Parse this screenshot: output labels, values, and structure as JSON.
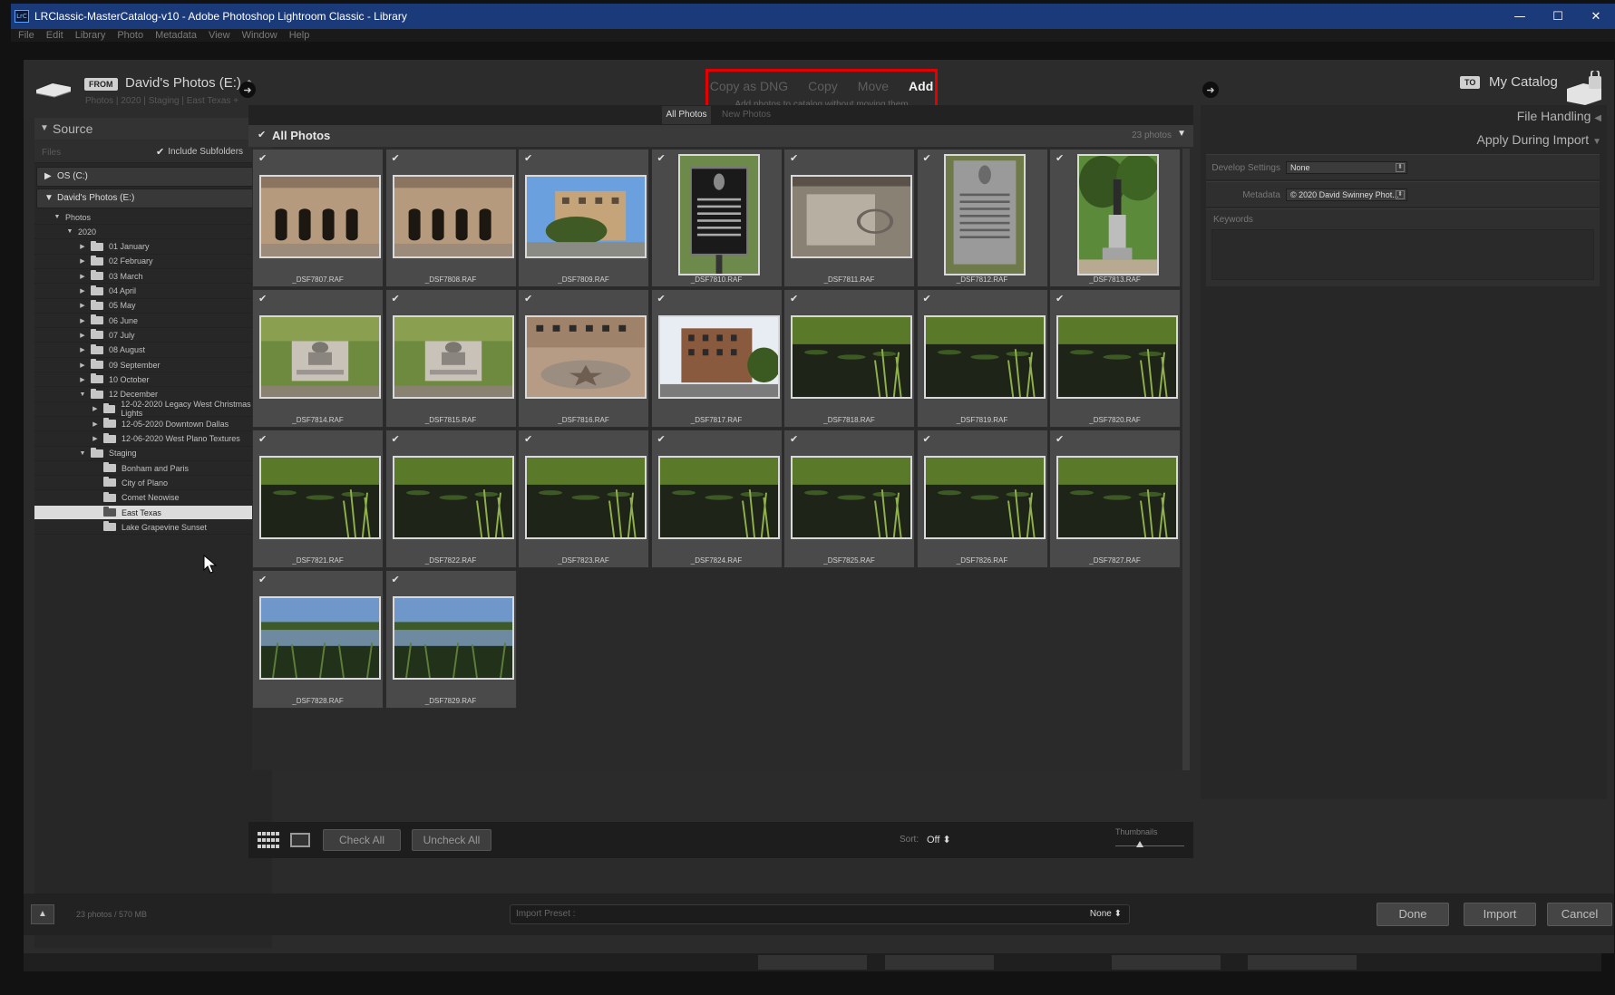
{
  "window": {
    "app_icon": "LrC",
    "title": "LRClassic-MasterCatalog-v10 - Adobe Photoshop Lightroom Classic - Library",
    "controls": [
      "—",
      "☐",
      "✕"
    ]
  },
  "menu": [
    "File",
    "Edit",
    "Library",
    "Photo",
    "Metadata",
    "View",
    "Window",
    "Help"
  ],
  "header": {
    "from_badge": "FROM",
    "source_name": "David's Photos (E:)",
    "source_path": "Photos | 2020 | Staging | East Texas +",
    "modes": [
      "Copy as DNG",
      "Copy",
      "Move",
      "Add"
    ],
    "active_mode": "Add",
    "mode_description": "Add photos to catalog without moving them",
    "to_badge": "TO",
    "dest_name": "My Catalog",
    "highlight_color": "#e40000"
  },
  "source": {
    "title": "Source",
    "files_label": "Files",
    "include_subfolders": "Include Subfolders",
    "volumes": [
      "OS (C:)",
      "David's Photos (E:)"
    ],
    "tree": [
      {
        "label": "Photos",
        "indent": 1,
        "tri": "▼",
        "folder": false
      },
      {
        "label": "2020",
        "indent": 2,
        "tri": "▼",
        "folder": false
      },
      {
        "label": "01 January",
        "indent": 3,
        "tri": "▶",
        "folder": true
      },
      {
        "label": "02 February",
        "indent": 3,
        "tri": "▶",
        "folder": true
      },
      {
        "label": "03 March",
        "indent": 3,
        "tri": "▶",
        "folder": true
      },
      {
        "label": "04 April",
        "indent": 3,
        "tri": "▶",
        "folder": true
      },
      {
        "label": "05 May",
        "indent": 3,
        "tri": "▶",
        "folder": true
      },
      {
        "label": "06 June",
        "indent": 3,
        "tri": "▶",
        "folder": true
      },
      {
        "label": "07 July",
        "indent": 3,
        "tri": "▶",
        "folder": true
      },
      {
        "label": "08 August",
        "indent": 3,
        "tri": "▶",
        "folder": true
      },
      {
        "label": "09 September",
        "indent": 3,
        "tri": "▶",
        "folder": true
      },
      {
        "label": "10 October",
        "indent": 3,
        "tri": "▶",
        "folder": true
      },
      {
        "label": "12 December",
        "indent": 3,
        "tri": "▼",
        "folder": true
      },
      {
        "label": "12-02-2020 Legacy West Christmas Lights",
        "indent": 4,
        "tri": "▶",
        "folder": true
      },
      {
        "label": "12-05-2020 Downtown Dallas",
        "indent": 4,
        "tri": "▶",
        "folder": true
      },
      {
        "label": "12-06-2020 West Plano Textures",
        "indent": 4,
        "tri": "▶",
        "folder": true
      },
      {
        "label": "Staging",
        "indent": 3,
        "tri": "▼",
        "folder": true
      },
      {
        "label": "Bonham and Paris",
        "indent": 4,
        "tri": "",
        "folder": true
      },
      {
        "label": "City of Plano",
        "indent": 4,
        "tri": "",
        "folder": true
      },
      {
        "label": "Comet Neowise",
        "indent": 4,
        "tri": "",
        "folder": true
      },
      {
        "label": "East Texas",
        "indent": 4,
        "tri": "",
        "folder": true,
        "selected": true
      },
      {
        "label": "Lake Grapevine Sunset",
        "indent": 4,
        "tri": "",
        "folder": true
      }
    ]
  },
  "center": {
    "tabs": [
      "All Photos",
      "New Photos"
    ],
    "grid_title": "All Photos",
    "photo_count": "23 photos",
    "photos": [
      {
        "name": "_DSF7807.RAF",
        "kind": "building",
        "orient": "h"
      },
      {
        "name": "_DSF7808.RAF",
        "kind": "building",
        "orient": "h"
      },
      {
        "name": "_DSF7809.RAF",
        "kind": "courthouse",
        "orient": "h"
      },
      {
        "name": "_DSF7810.RAF",
        "kind": "marker",
        "orient": "v"
      },
      {
        "name": "_DSF7811.RAF",
        "kind": "stone",
        "orient": "h"
      },
      {
        "name": "_DSF7812.RAF",
        "kind": "plaque",
        "orient": "v"
      },
      {
        "name": "_DSF7813.RAF",
        "kind": "monument",
        "orient": "v"
      },
      {
        "name": "_DSF7814.RAF",
        "kind": "statue",
        "orient": "h"
      },
      {
        "name": "_DSF7815.RAF",
        "kind": "statue",
        "orient": "h"
      },
      {
        "name": "_DSF7816.RAF",
        "kind": "plaza",
        "orient": "h"
      },
      {
        "name": "_DSF7817.RAF",
        "kind": "courthouse2",
        "orient": "h"
      },
      {
        "name": "_DSF7818.RAF",
        "kind": "pond",
        "orient": "h"
      },
      {
        "name": "_DSF7819.RAF",
        "kind": "pond",
        "orient": "h"
      },
      {
        "name": "_DSF7820.RAF",
        "kind": "pond",
        "orient": "h"
      },
      {
        "name": "_DSF7821.RAF",
        "kind": "pond",
        "orient": "h"
      },
      {
        "name": "_DSF7822.RAF",
        "kind": "pond",
        "orient": "h"
      },
      {
        "name": "_DSF7823.RAF",
        "kind": "pond",
        "orient": "h"
      },
      {
        "name": "_DSF7824.RAF",
        "kind": "pond",
        "orient": "h"
      },
      {
        "name": "_DSF7825.RAF",
        "kind": "pond",
        "orient": "h"
      },
      {
        "name": "_DSF7826.RAF",
        "kind": "pond",
        "orient": "h"
      },
      {
        "name": "_DSF7827.RAF",
        "kind": "pond",
        "orient": "h"
      },
      {
        "name": "_DSF7828.RAF",
        "kind": "lake",
        "orient": "h"
      },
      {
        "name": "_DSF7829.RAF",
        "kind": "lake",
        "orient": "h"
      }
    ],
    "check_all": "Check All",
    "uncheck_all": "Uncheck All",
    "sort_label": "Sort:",
    "sort_value": "Off ⬍",
    "thumbnails_label": "Thumbnails",
    "thumbnail_size": 0.35
  },
  "right": {
    "file_handling": "File Handling",
    "apply_during_import": "Apply During Import",
    "develop_settings_label": "Develop Settings",
    "develop_settings_value": "None",
    "metadata_label": "Metadata",
    "metadata_value": "© 2020 David Swinney Phot...",
    "keywords_label": "Keywords"
  },
  "footer": {
    "summary": "23 photos / 570 MB",
    "import_preset_label": "Import Preset :",
    "import_preset_value": "None ⬍",
    "done": "Done",
    "import": "Import",
    "cancel": "Cancel"
  }
}
